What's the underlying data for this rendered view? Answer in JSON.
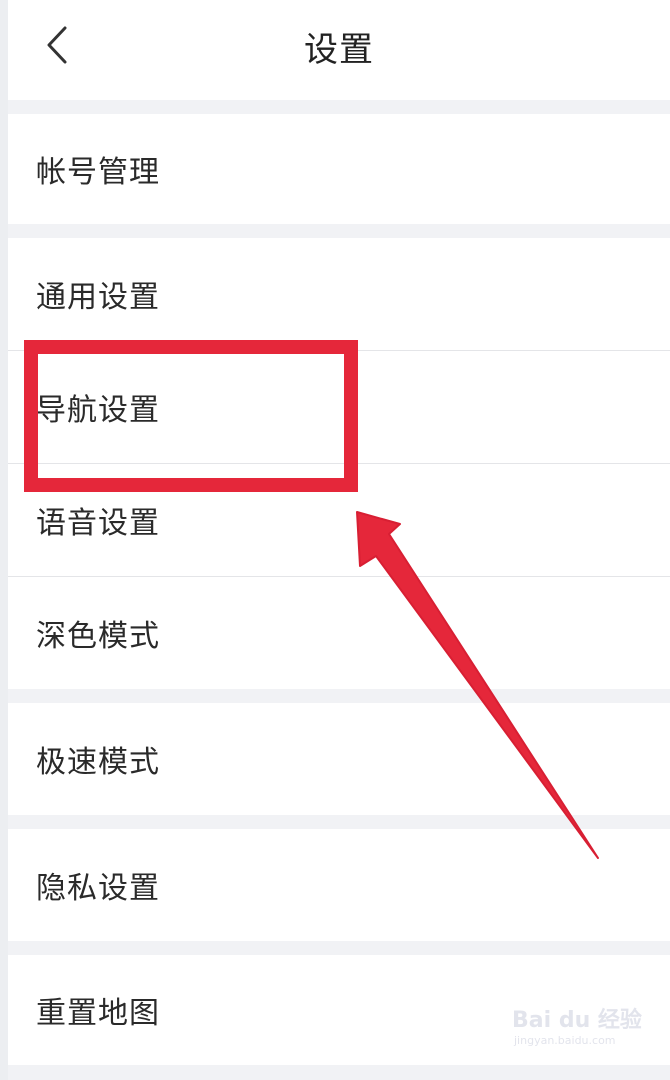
{
  "header": {
    "title": "设置",
    "back_icon": "chevron-left-icon"
  },
  "settings": {
    "account": "帐号管理",
    "general": "通用设置",
    "navigation": "导航设置",
    "voice": "语音设置",
    "dark_mode": "深色模式",
    "speed_mode": "极速模式",
    "privacy": "隐私设置",
    "reset_map": "重置地图"
  },
  "annotation": {
    "highlight_color": "#e5273a",
    "arrow_color": "#e5273a",
    "highlighted_item": "导航设置"
  },
  "watermark": {
    "logo": "Bai du 经验",
    "url": "jingyan.baidu.com"
  }
}
